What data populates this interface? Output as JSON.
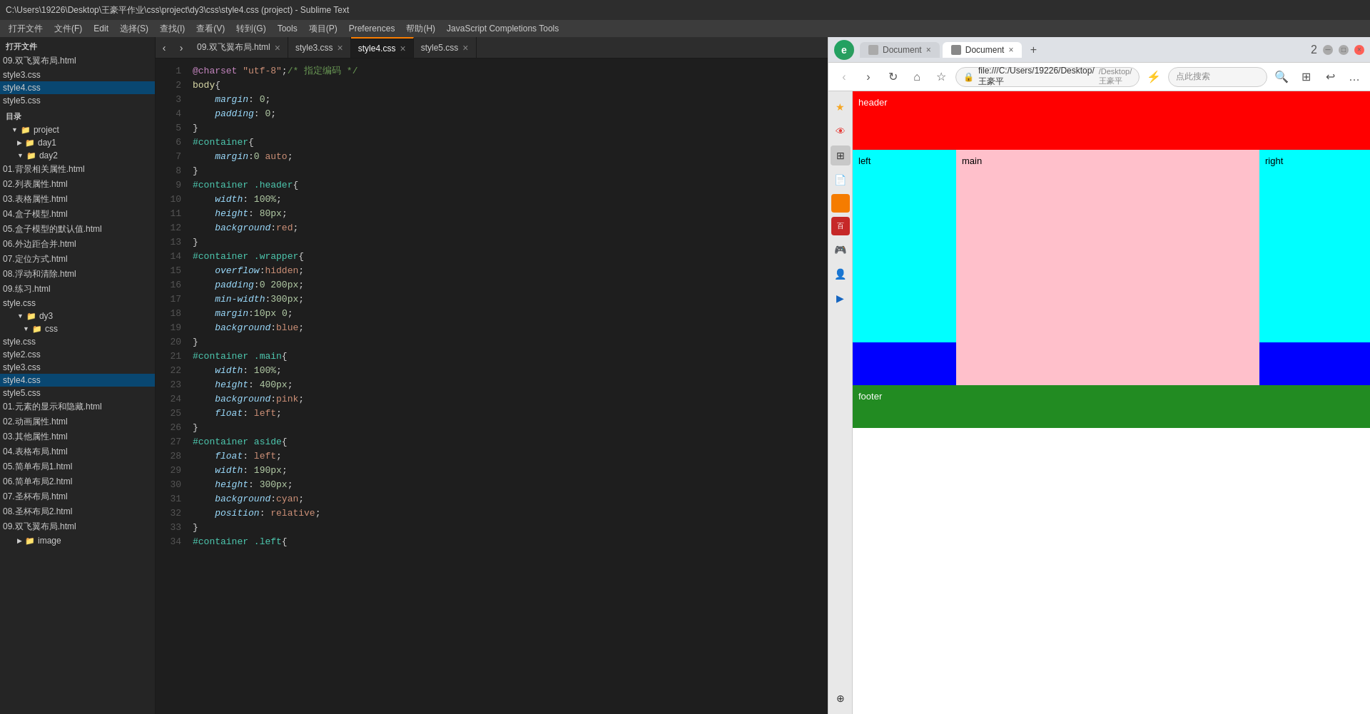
{
  "window": {
    "title": "C:\\Users\\19226\\Desktop\\王豪平作业\\css\\project\\dy3\\css\\style4.css (project) - Sublime Text"
  },
  "menu": {
    "items": [
      "打开文件",
      "文件(F)",
      "Edit",
      "选择(S)",
      "查找(I)",
      "查看(V)",
      "转到(G)",
      "Tools",
      "项目(P)",
      "Preferences",
      "帮助(H)",
      "JavaScript Completions Tools"
    ]
  },
  "sidebar": {
    "open_files_label": "打开文件",
    "files": [
      "09.双飞翼布局.html",
      "style3.css",
      "style4.css",
      "style5.css"
    ],
    "tree_label": "目录",
    "tree": {
      "project": "project",
      "day1": "day1",
      "day2": "day2",
      "day2_files": [
        "01.背景相关属性.html",
        "02.列表属性.html",
        "03.表格属性.html",
        "04.盒子模型.html",
        "05.盒子模型的默认值.html",
        "06.外边距合并.html",
        "07.定位方式.html",
        "08.浮动和清除.html",
        "09.练习.html",
        "style.css"
      ],
      "dy3": "dy3",
      "dy3_css": "css",
      "dy3_css_files": [
        "style.css",
        "style2.css",
        "style3.css",
        "style4.css",
        "style5.css"
      ],
      "dy3_html_files": [
        "01.元素的显示和隐藏.html",
        "02.动画属性.html",
        "03.其他属性.html",
        "04.表格布局.html",
        "05.简单布局1.html",
        "06.简单布局2.html",
        "07.圣杯布局.html",
        "08.圣杯布局2.html",
        "09.双飞翼布局.html"
      ],
      "image": "image"
    }
  },
  "editor": {
    "tabs": [
      {
        "label": "09.双飞翼布局.html",
        "active": false
      },
      {
        "label": "style3.css",
        "active": false
      },
      {
        "label": "style4.css",
        "active": true
      },
      {
        "label": "style5.css",
        "active": false
      }
    ],
    "lines": [
      {
        "num": "1",
        "content": "@charset \"utf-8\";/* 指定编码 */"
      },
      {
        "num": "2",
        "content": "body{"
      },
      {
        "num": "3",
        "content": "    margin: 0;"
      },
      {
        "num": "4",
        "content": "    padding: 0;"
      },
      {
        "num": "5",
        "content": "}"
      },
      {
        "num": "6",
        "content": "#container{"
      },
      {
        "num": "7",
        "content": "    margin:0 auto;"
      },
      {
        "num": "8",
        "content": "}"
      },
      {
        "num": "9",
        "content": "#container .header{"
      },
      {
        "num": "10",
        "content": "    width: 100%;"
      },
      {
        "num": "11",
        "content": "    height: 80px;"
      },
      {
        "num": "12",
        "content": "    background:red;"
      },
      {
        "num": "13",
        "content": "}"
      },
      {
        "num": "14",
        "content": "#container .wrapper{"
      },
      {
        "num": "15",
        "content": "    overflow:hidden;"
      },
      {
        "num": "16",
        "content": "    padding:0 200px;"
      },
      {
        "num": "17",
        "content": "    min-width:300px;"
      },
      {
        "num": "18",
        "content": "    margin:10px 0;"
      },
      {
        "num": "19",
        "content": "    background:blue;"
      },
      {
        "num": "20",
        "content": "}"
      },
      {
        "num": "21",
        "content": "#container .main{"
      },
      {
        "num": "22",
        "content": "    width: 100%;"
      },
      {
        "num": "23",
        "content": "    height: 400px;"
      },
      {
        "num": "24",
        "content": "    background:pink;"
      },
      {
        "num": "25",
        "content": "    float: left;"
      },
      {
        "num": "26",
        "content": "}"
      },
      {
        "num": "27",
        "content": "#container aside{"
      },
      {
        "num": "28",
        "content": "    float: left;"
      },
      {
        "num": "29",
        "content": "    width: 190px;"
      },
      {
        "num": "30",
        "content": "    height: 300px;"
      },
      {
        "num": "31",
        "content": "    background:cyan;"
      },
      {
        "num": "32",
        "content": "    position: relative;"
      },
      {
        "num": "33",
        "content": "}"
      },
      {
        "num": "34",
        "content": "#container .left{"
      }
    ]
  },
  "browser": {
    "tabs": [
      {
        "label": "Document",
        "active": false
      },
      {
        "label": "Document",
        "active": true
      }
    ],
    "address": "file:///C:/Users/19226/Desktop/王豪平",
    "preview": {
      "header_label": "header",
      "left_label": "left",
      "main_label": "main",
      "right_label": "right",
      "footer_label": "footer"
    }
  },
  "colors": {
    "accent": "#007acc",
    "preview_header": "red",
    "preview_left": "cyan",
    "preview_main": "pink",
    "preview_right": "cyan",
    "preview_footer": "#228B22",
    "preview_accent": "blue"
  }
}
